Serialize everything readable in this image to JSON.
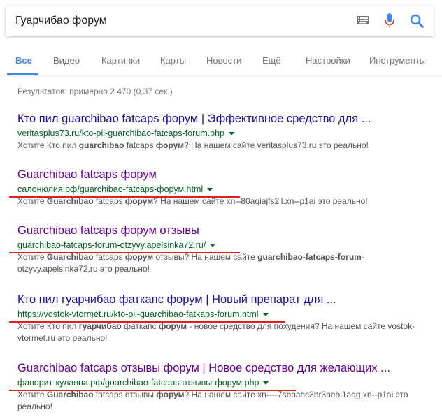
{
  "search": {
    "query": "Гуарчибао форум",
    "keyboard_icon": "keyboard-icon",
    "mic_icon": "microphone-icon",
    "search_icon": "search-icon"
  },
  "tabs": [
    {
      "label": "Все",
      "active": true
    },
    {
      "label": "Видео"
    },
    {
      "label": "Картинки"
    },
    {
      "label": "Карты"
    },
    {
      "label": "Новости"
    },
    {
      "label": "Ещё"
    },
    {
      "label": "Настройки"
    },
    {
      "label": "Инструменты"
    }
  ],
  "stats": "Результатов: примерно 2 470 (0,37 сек.)",
  "results": [
    {
      "title": "Кто пил guarchibao fatcaps форум | Эффективное средство для ...",
      "url": "veritasplus73.ru/kto-pil-guarchibao-fatcaps-forum.php",
      "snippet": [
        {
          "t": "Хотите Кто пил "
        },
        {
          "t": "guarchibao",
          "b": true
        },
        {
          "t": " fatcaps "
        },
        {
          "t": "форум",
          "b": true
        },
        {
          "t": "? На нашем сайте veritasplus73.ru это реально!"
        }
      ]
    },
    {
      "title": "Guarchibao fatcaps форум",
      "url": "салонюлия.рф/guarchibao-fatcaps-форум.html",
      "snippet": [
        {
          "t": "Хотите "
        },
        {
          "t": "Guarchibao",
          "b": true
        },
        {
          "t": " fatcaps "
        },
        {
          "t": "форум",
          "b": true
        },
        {
          "t": "? На нашем сайте xn--80aqiajfs2il.xn--p1ai это реально!"
        }
      ]
    },
    {
      "title": "Guarchibao fatcaps форум отзывы",
      "url": "guarchibao-fatcaps-forum-otzyvy.apelsinka72.ru/",
      "snippet": [
        {
          "t": "Хотите "
        },
        {
          "t": "Guarchibao",
          "b": true
        },
        {
          "t": " fatcaps "
        },
        {
          "t": "форум",
          "b": true
        },
        {
          "t": " отзывы? На нашем сайте "
        },
        {
          "t": "guarchibao-fatcaps-forum",
          "b": true
        },
        {
          "t": "-otzyvy.apelsinka72.ru это реально!"
        }
      ]
    },
    {
      "title": "Кто пил гуарчибао фаткапс форум | Новый препарат для ...",
      "url": "https://vostok-vtormet.ru/kto-pil-guarchibao-fatkaps-forum.html",
      "snippet": [
        {
          "t": "Хотите Кто пил "
        },
        {
          "t": "гуарчибао",
          "b": true
        },
        {
          "t": " фаткапс "
        },
        {
          "t": "форум",
          "b": true
        },
        {
          "t": " - новое средство для похудения? На нашем сайте vostok-vtormet.ru это реально!"
        }
      ]
    },
    {
      "title": "Guarchibao fatcaps отзывы форум | Новое средство для желающих ...",
      "url": "фаворит-кулавна.рф/guarchibao-fatcaps-отзывы-форум.php",
      "snippet": [
        {
          "t": "Хотите "
        },
        {
          "t": "Guarchibao",
          "b": true
        },
        {
          "t": " fatcaps отзывы "
        },
        {
          "t": "форум",
          "b": true
        },
        {
          "t": "? На нашем сайте xn----7sbbahc3br3aeoi1aqg.xn--p1ai это реально!"
        }
      ]
    }
  ],
  "colors": {
    "link": "#1a0dab",
    "visited": "#660099",
    "url": "#006621",
    "snippet": "#545454",
    "accent": "#4285f4",
    "annotation": "#e02020"
  }
}
